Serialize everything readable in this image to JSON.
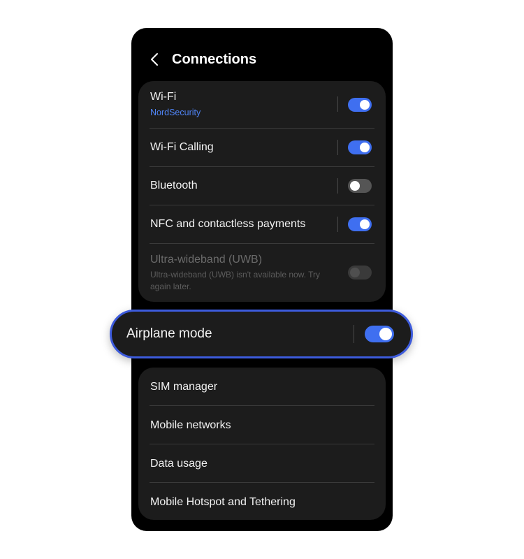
{
  "header": {
    "title": "Connections",
    "back_icon": "chevron-left-icon"
  },
  "connections": [
    {
      "label": "Wi-Fi",
      "subtitle": "NordSecurity",
      "toggle": "on",
      "enabled": true
    },
    {
      "label": "Wi-Fi Calling",
      "toggle": "on",
      "enabled": true
    },
    {
      "label": "Bluetooth",
      "toggle": "off",
      "enabled": true
    },
    {
      "label": "NFC and contactless payments",
      "toggle": "on",
      "enabled": true
    },
    {
      "label": "Ultra-wideband (UWB)",
      "subtitle": "Ultra-wideband (UWB) isn't available now. Try again later.",
      "toggle": "off",
      "enabled": false
    }
  ],
  "airplane": {
    "label": "Airplane mode",
    "toggle": "on"
  },
  "more": [
    {
      "label": "SIM manager",
      "enabled": true
    },
    {
      "label": "Mobile networks",
      "enabled": false
    },
    {
      "label": "Data usage",
      "enabled": true
    },
    {
      "label": "Mobile Hotspot and Tethering",
      "enabled": true
    }
  ],
  "colors": {
    "accent": "#3f6ff0",
    "highlight_border": "#3d5bdc",
    "link": "#4f84f5",
    "card": "#1c1c1c",
    "background": "#000000"
  }
}
